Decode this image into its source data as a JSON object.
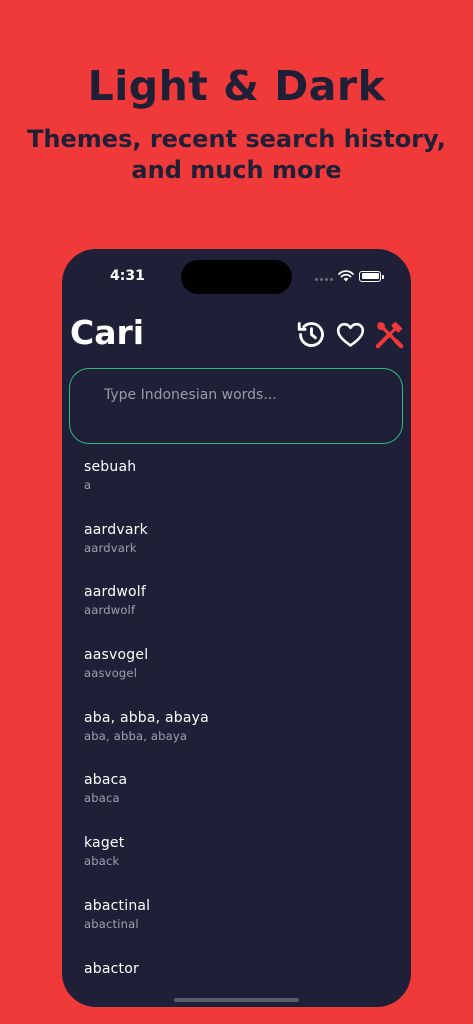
{
  "promo": {
    "title": "Light & Dark",
    "subtitle": "Themes, recent search history,\nand much more"
  },
  "status_bar": {
    "time": "4:31",
    "icons": [
      "cellular-signal-icon",
      "wifi-icon",
      "battery-icon"
    ]
  },
  "header": {
    "title": "Cari",
    "actions": [
      {
        "name": "history-icon",
        "color": "#ffffff"
      },
      {
        "name": "heart-icon",
        "color": "#ffffff"
      },
      {
        "name": "tools-icon",
        "color": "#f03a3a"
      }
    ]
  },
  "search": {
    "placeholder": "Type Indonesian words...",
    "value": "",
    "border_color": "#2fb683"
  },
  "words": [
    {
      "term": "sebuah",
      "translation": "a"
    },
    {
      "term": "aardvark",
      "translation": "aardvark"
    },
    {
      "term": "aardwolf",
      "translation": "aardwolf"
    },
    {
      "term": "aasvogel",
      "translation": "aasvogel"
    },
    {
      "term": "aba, abba, abaya",
      "translation": "aba, abba, abaya"
    },
    {
      "term": "abaca",
      "translation": "abaca"
    },
    {
      "term": "kaget",
      "translation": "aback"
    },
    {
      "term": "abactinal",
      "translation": "abactinal"
    },
    {
      "term": "abactor",
      "translation": ""
    }
  ],
  "colors": {
    "background": "#f03a3a",
    "phone": "#1f1f37",
    "accent": "#2fb683"
  }
}
